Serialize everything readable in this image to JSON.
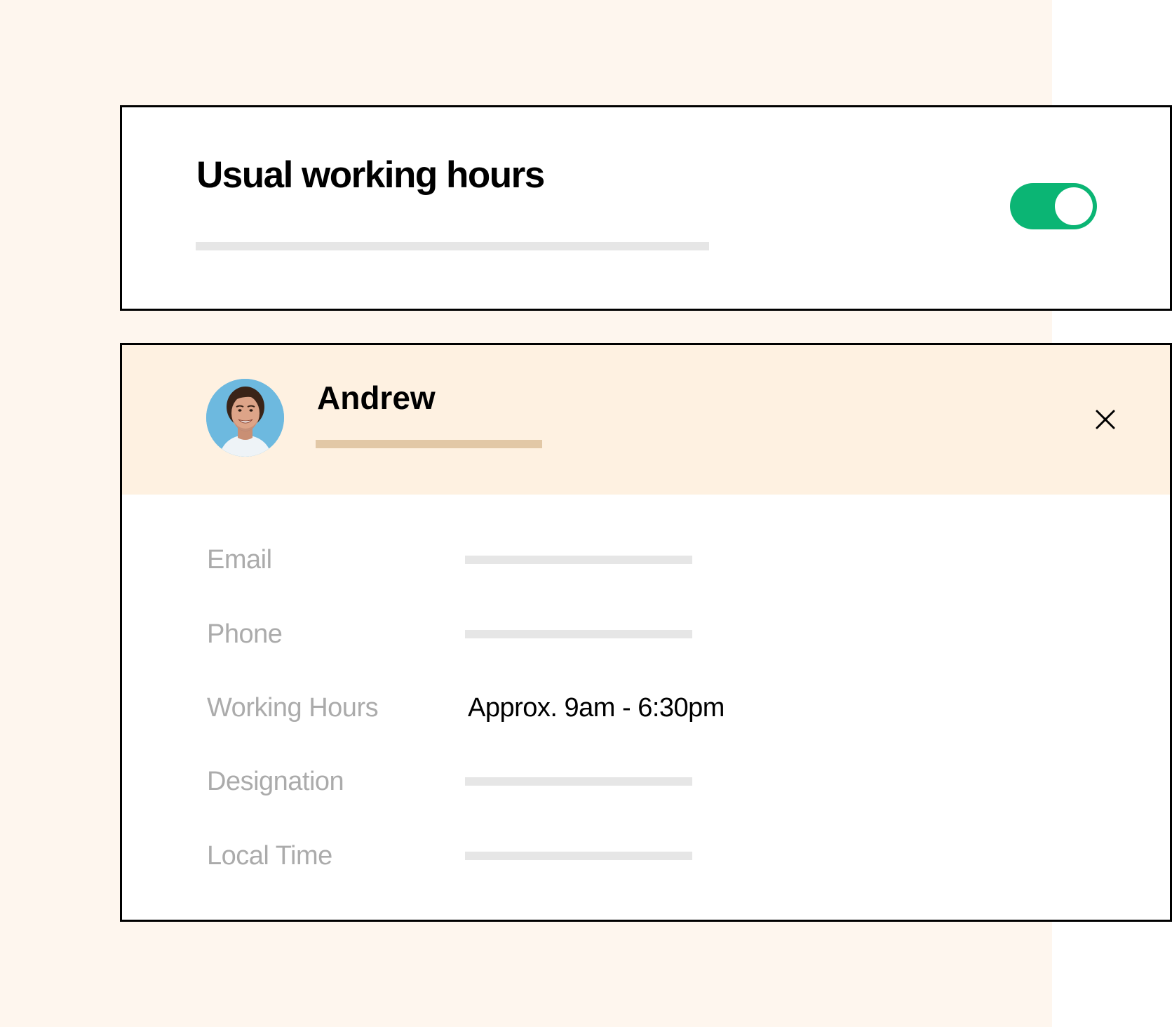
{
  "colors": {
    "page_background": "#FEF6EE",
    "toggle_on": "#0BB574",
    "profile_header_background": "#FEF1E1",
    "label_gray": "#ABABAB",
    "placeholder_gray": "#E6E6E6",
    "name_underline": "#E2C8A6",
    "avatar_background": "#6DB9DF"
  },
  "hours_card": {
    "title": "Usual working hours",
    "toggle": {
      "state": "on"
    }
  },
  "profile_card": {
    "name": "Andrew",
    "avatar_icon": "person-photo",
    "close_icon": "close-x",
    "fields": [
      {
        "label": "Email",
        "value": null
      },
      {
        "label": "Phone",
        "value": null
      },
      {
        "label": "Working Hours",
        "value": "Approx. 9am - 6:30pm"
      },
      {
        "label": "Designation",
        "value": null
      },
      {
        "label": "Local Time",
        "value": null
      }
    ]
  }
}
